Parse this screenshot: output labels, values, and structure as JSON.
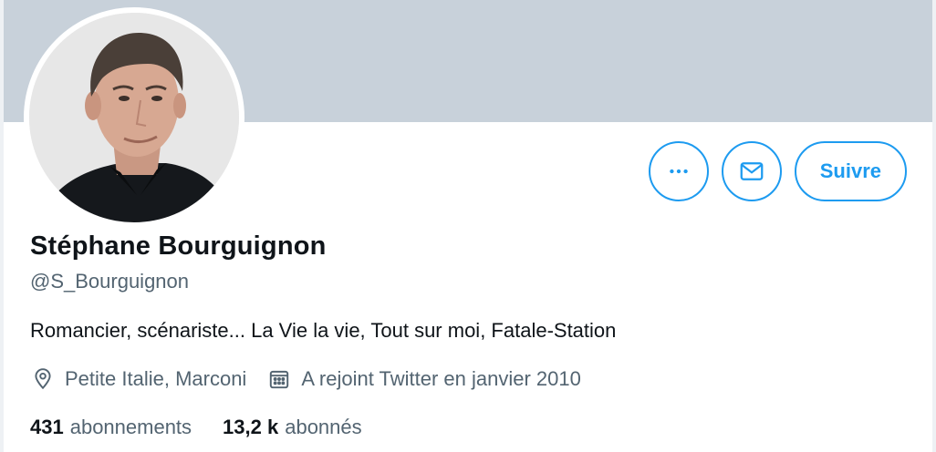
{
  "profile": {
    "name": "Stéphane Bourguignon",
    "handle": "@S_Bourguignon",
    "bio": "Romancier, scénariste... La Vie la vie, Tout sur moi, Fatale-Station",
    "location": "Petite Italie, Marconi",
    "joined": "A rejoint Twitter en janvier 2010"
  },
  "actions": {
    "more_icon": "more-horizontal-icon",
    "message_icon": "envelope-icon",
    "follow_label": "Suivre"
  },
  "stats": {
    "following_count": "431",
    "following_label": "abonnements",
    "followers_count": "13,2 k",
    "followers_label": "abonnés"
  },
  "colors": {
    "accent": "#1d9bf0",
    "banner": "#c8d1da",
    "secondary_text": "#536471",
    "primary_text": "#0f1419"
  }
}
